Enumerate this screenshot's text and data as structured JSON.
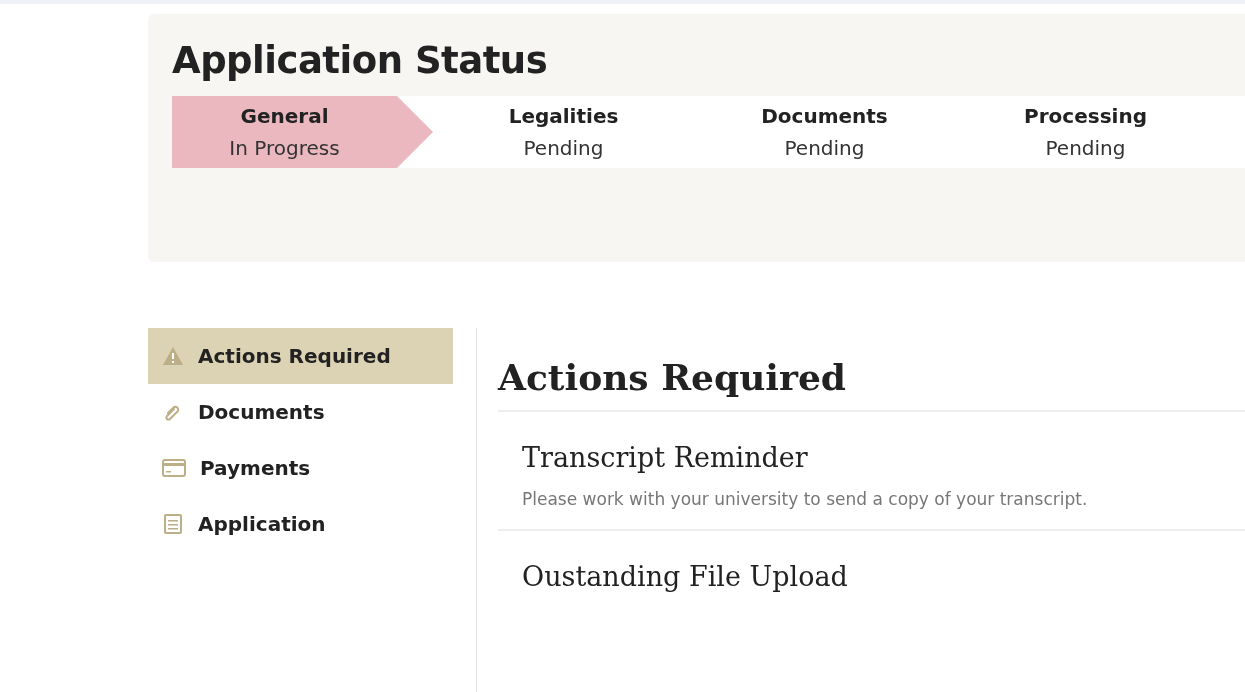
{
  "status_card": {
    "title": "Application Status",
    "steps": [
      {
        "name": "General",
        "status": "In Progress",
        "selected": true
      },
      {
        "name": "Legalities",
        "status": "Pending",
        "selected": false
      },
      {
        "name": "Documents",
        "status": "Pending",
        "selected": false
      },
      {
        "name": "Processing",
        "status": "Pending",
        "selected": false
      }
    ]
  },
  "sidebar": {
    "items": [
      {
        "label": "Actions Required",
        "kind": "warning",
        "selected": true
      },
      {
        "label": "Documents",
        "kind": "paperclip",
        "selected": false
      },
      {
        "label": "Payments",
        "kind": "card",
        "selected": false
      },
      {
        "label": "Application",
        "kind": "form",
        "selected": false
      }
    ]
  },
  "main": {
    "heading": "Actions Required",
    "actions": [
      {
        "title": "Transcript Reminder",
        "text": "Please work with your university to send a copy of your transcript."
      },
      {
        "title": "Oustanding File Upload"
      }
    ]
  }
}
